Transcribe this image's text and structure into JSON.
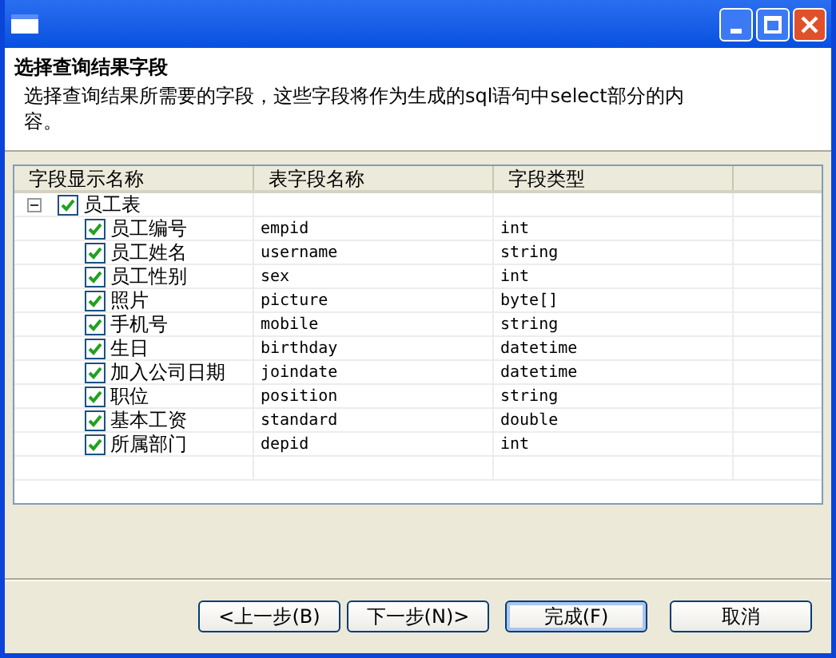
{
  "header": {
    "title": "选择查询结果字段",
    "description": "选择查询结果所需要的字段，这些字段将作为生成的sql语句中select部分的内容。"
  },
  "table": {
    "columns": [
      "字段显示名称",
      "表字段名称",
      "字段类型"
    ],
    "rows": [
      {
        "name": "员工表",
        "checked": true,
        "expanded": true,
        "children": [
          {
            "name": "员工编号",
            "field": "empid",
            "type": "int",
            "checked": true
          },
          {
            "name": "员工姓名",
            "field": "username",
            "type": "string",
            "checked": true
          },
          {
            "name": "员工性别",
            "field": "sex",
            "type": "int",
            "checked": true
          },
          {
            "name": "照片",
            "field": "picture",
            "type": "byte[]",
            "checked": true
          },
          {
            "name": "手机号",
            "field": "mobile",
            "type": "string",
            "checked": true
          },
          {
            "name": "生日",
            "field": "birthday",
            "type": "datetime",
            "checked": true
          },
          {
            "name": "加入公司日期",
            "field": "joindate",
            "type": "datetime",
            "checked": true
          },
          {
            "name": "职位",
            "field": "position",
            "type": "string",
            "checked": true
          },
          {
            "name": "基本工资",
            "field": "standard",
            "type": "double",
            "checked": true
          },
          {
            "name": "所属部门",
            "field": "depid",
            "type": "int",
            "checked": true
          }
        ]
      }
    ]
  },
  "buttons": [
    {
      "label": "<上一步(B)",
      "disabled": false,
      "default": false
    },
    {
      "label": "下一步(N)>",
      "disabled": false,
      "default": false
    },
    {
      "label": "完成(F)",
      "disabled": false,
      "default": true
    },
    {
      "label": "取消",
      "disabled": false,
      "default": false
    }
  ]
}
